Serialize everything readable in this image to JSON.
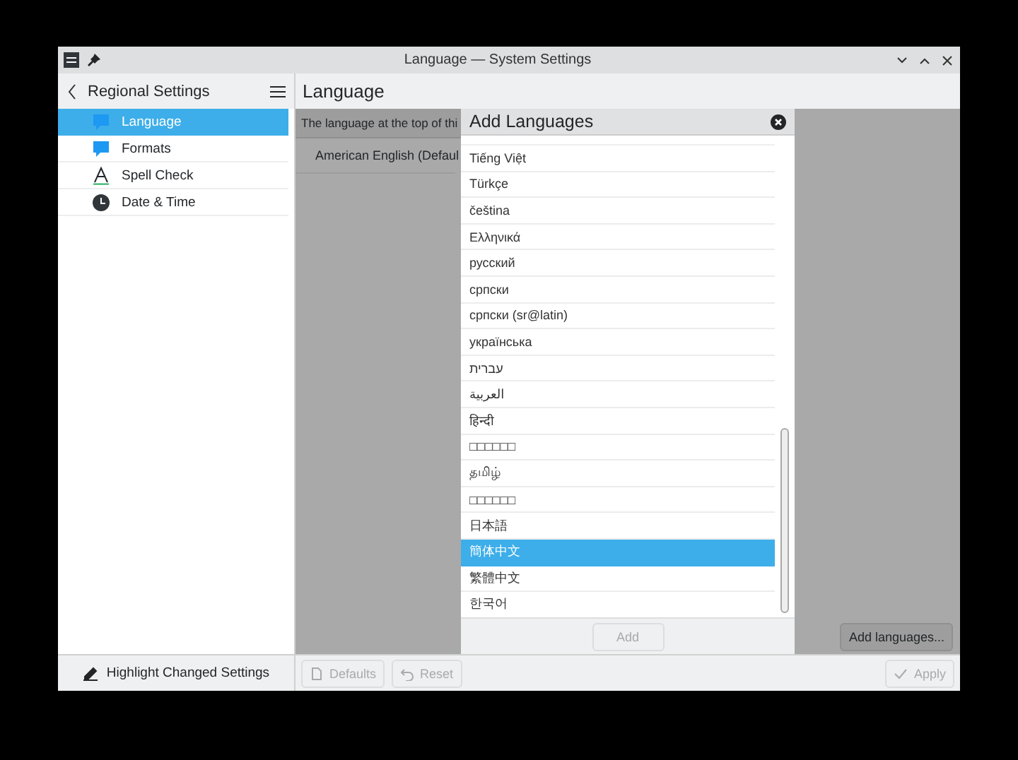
{
  "window": {
    "title": "Language — System Settings"
  },
  "sidebar": {
    "title": "Regional Settings",
    "items": [
      {
        "label": "Language",
        "kind": "speech",
        "selected": true
      },
      {
        "label": "Formats",
        "kind": "speech",
        "selected": false
      },
      {
        "label": "Spell Check",
        "kind": "letter",
        "selected": false
      },
      {
        "label": "Date & Time",
        "kind": "clock",
        "selected": false
      }
    ],
    "footer": "Highlight Changed Settings"
  },
  "page": {
    "title": "Language",
    "info": "The language at the top of thi",
    "languages": [
      "American English (Defaul"
    ],
    "add_button": "Add languages..."
  },
  "dialog": {
    "title": "Add Languages",
    "items": [
      {
        "label": "Tiếng Việt",
        "selected": false
      },
      {
        "label": "Türkçe",
        "selected": false
      },
      {
        "label": "čeština",
        "selected": false
      },
      {
        "label": "Ελληνικά",
        "selected": false
      },
      {
        "label": "русский",
        "selected": false
      },
      {
        "label": "српски",
        "selected": false
      },
      {
        "label": "српски (sr@latin)",
        "selected": false
      },
      {
        "label": "українська",
        "selected": false
      },
      {
        "label": "עברית",
        "selected": false
      },
      {
        "label": "العربية",
        "selected": false
      },
      {
        "label": "हिन्दी",
        "selected": false
      },
      {
        "label": "□□□□□□",
        "selected": false
      },
      {
        "label": "தமிழ்",
        "selected": false
      },
      {
        "label": "□□□□□□",
        "selected": false
      },
      {
        "label": "日本語",
        "selected": false
      },
      {
        "label": "簡体中文",
        "selected": true
      },
      {
        "label": "繁體中文",
        "selected": false
      },
      {
        "label": "한국어",
        "selected": false
      }
    ],
    "add_button": {
      "label": "Add",
      "disabled": true
    }
  },
  "footer_buttons": [
    {
      "label": "Defaults",
      "kind": "document",
      "disabled": true
    },
    {
      "label": "Reset",
      "kind": "undo",
      "disabled": true
    },
    {
      "label": "Apply",
      "kind": "check",
      "disabled": true
    }
  ]
}
